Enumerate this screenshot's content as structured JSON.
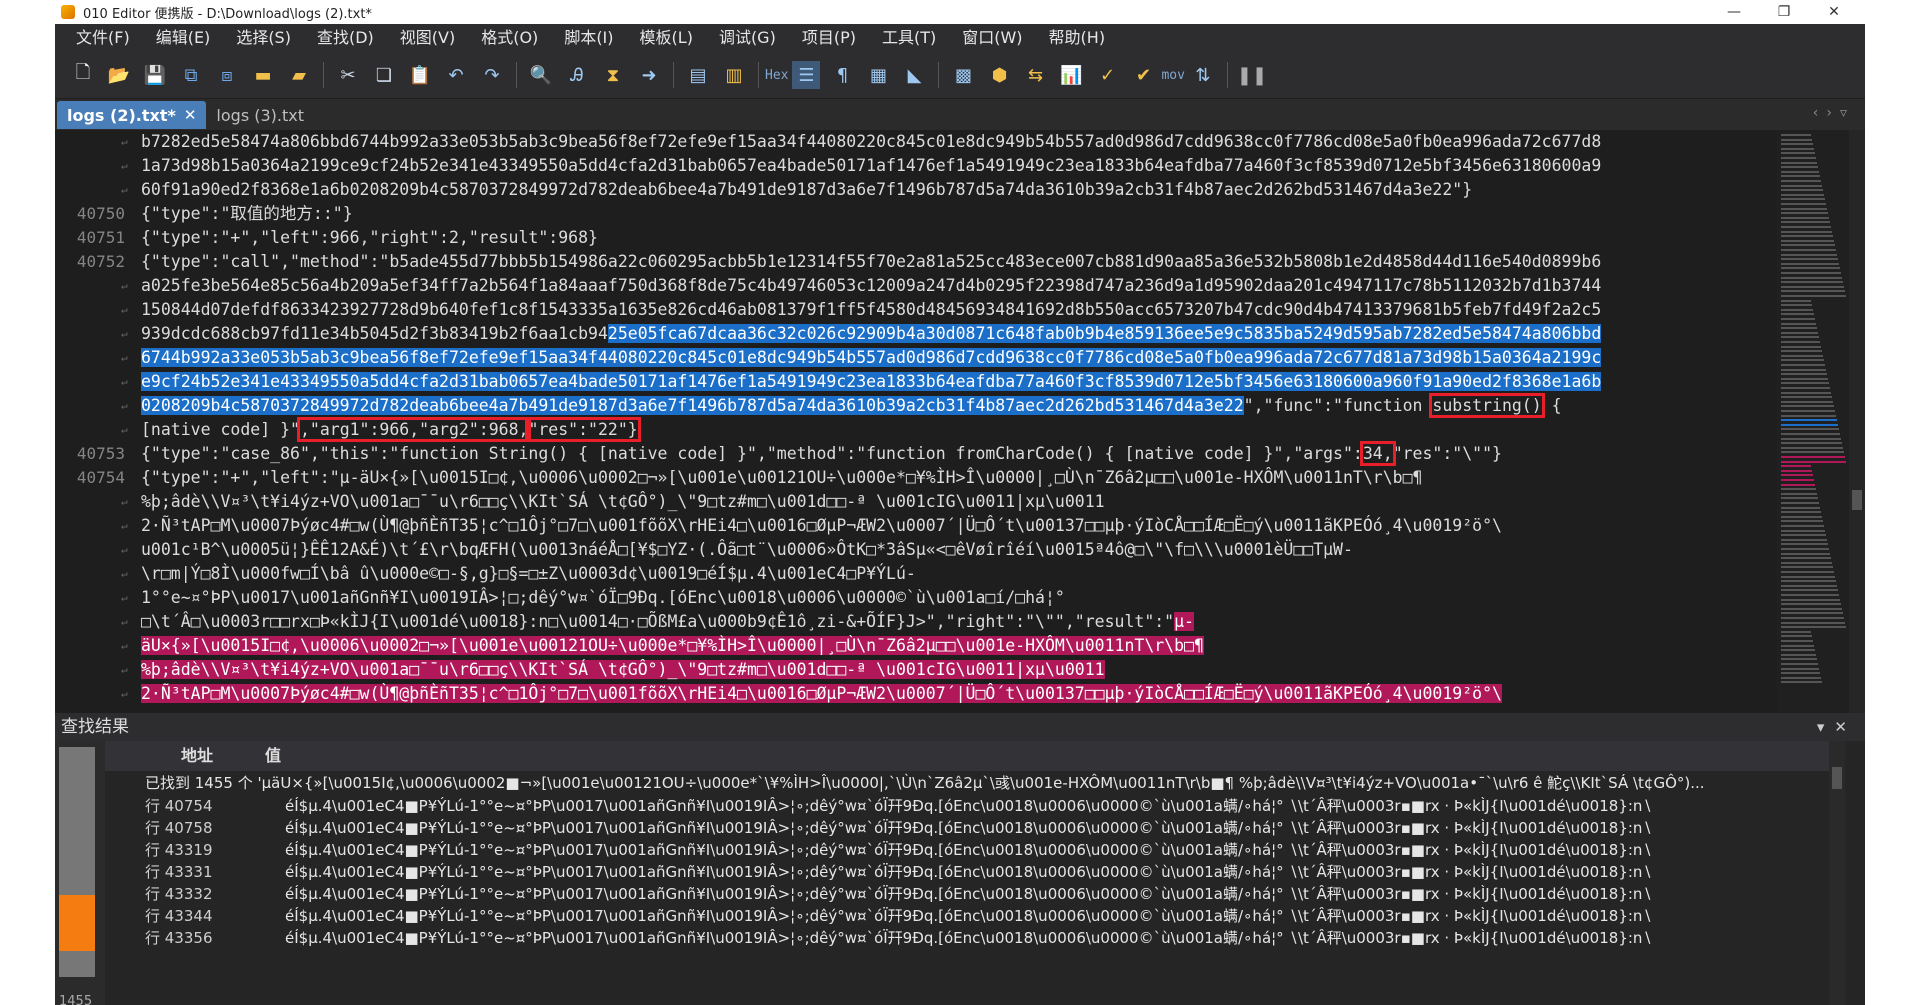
{
  "window": {
    "title": "010 Editor 便携版 - D:\\Download\\logs (2).txt*",
    "controls": [
      "—",
      "❐",
      "✕"
    ]
  },
  "menu": [
    "文件(F)",
    "编辑(E)",
    "选择(S)",
    "查找(D)",
    "视图(V)",
    "格式(O)",
    "脚本(I)",
    "模板(L)",
    "调试(G)",
    "项目(P)",
    "工具(T)",
    "窗口(W)",
    "帮助(H)"
  ],
  "toolbar": {
    "hex_label": "Hex",
    "mov_label": "mov",
    "icons": [
      "new-file-icon",
      "open-folder-icon",
      "save-icon",
      "save-all-icon",
      "save-as-icon",
      "folder-icon",
      "workspace-icon",
      "cut-icon",
      "copy-icon",
      "paste-icon",
      "undo-icon",
      "redo-icon",
      "find-icon",
      "find-replace-icon",
      "find-in-files-icon",
      "goto-icon",
      "script-icon",
      "template-icon",
      "hex-toggle-icon",
      "list-icon",
      "paragraph-icon",
      "columns-icon",
      "highlight-icon",
      "calculator-icon",
      "inspector-icon",
      "compare-icon",
      "histogram-icon",
      "checksum-icon",
      "verify-icon",
      "mov-icon",
      "convert-icon",
      "pause-icon"
    ]
  },
  "tabs": [
    {
      "label": "logs (2).txt*",
      "active": true
    },
    {
      "label": "logs (3).txt",
      "active": false
    }
  ],
  "editor": {
    "lines": [
      {
        "num": "",
        "text": "b7282ed5e58474a806bbd6744b992a33e053b5ab3c9bea56f8ef72efe9ef15aa34f44080220c845c01e8dc949b54b557ad0d986d7cdd9638cc0f7786cd08e5a0fb0ea996ada72c677d8"
      },
      {
        "num": "",
        "text": "1a73d98b15a0364a2199ce9cf24b52e341e43349550a5dd4cfa2d31bab0657ea4bade50171af1476ef1a5491949c23ea1833b64eafdba77a460f3cf8539d0712e5bf3456e63180600a9"
      },
      {
        "num": "",
        "text": "60f91a90ed2f8368e1a6b0208209b4c5870372849972d782deab6bee4a7b491de9187d3a6e7f1496b787d5a74da3610b39a2cb31f4b87aec2d262bd531467d4a3e22\"}"
      },
      {
        "num": "40750",
        "text": "{\"type\":\"取值的地方::\"}"
      },
      {
        "num": "40751",
        "text": "{\"type\":\"+\",\"left\":966,\"right\":2,\"result\":968}"
      },
      {
        "num": "40752",
        "text": "{\"type\":\"call\",\"method\":\"b5ade455d77bbb5b154986a22c060295acbb5b1e12314f55f70e2a81a525cc483ece007cb881d90aa85a36e532b5808b1e2d4858d44d116e540d0899b6"
      },
      {
        "num": "",
        "text": "a025fe3be564e85c56a4b209a5ef34ff7a2b564f1a84aaaf750d368f8de75c4b49746053c12009a247d4b0295f22398d747a236d9a1d95902daa201c4947117c78b5112032b7d1b3744"
      },
      {
        "num": "",
        "text": "150844d07defdf8633423927728d9b640fef1c8f1543335a1635e826cd46ab081379f1ff5f4580d48456934841692d8b550acc6573207b47cdc90d4b47413379681b5feb7fd49f2a2c5"
      },
      {
        "num": "",
        "pre": "939dcdc688cb97fd11e34b5045d2f3b83419b2f6aa1cb94",
        "sel": "25e05fca67dcaa36c32c026c92909b4a30d0871c648fab0b9b4e859136ee5e9c5835ba5249d595ab7282ed5e58474a806bbd"
      },
      {
        "num": "",
        "sel": "6744b992a33e053b5ab3c9bea56f8ef72efe9ef15aa34f44080220c845c01e8dc949b54b557ad0d986d7cdd9638cc0f7786cd08e5a0fb0ea996ada72c677d81a73d98b15a0364a2199c"
      },
      {
        "num": "",
        "sel": "e9cf24b52e341e43349550a5dd4cfa2d31bab0657ea4bade50171af1476ef1a5491949c23ea1833b64eafdba77a460f3cf8539d0712e5bf3456e63180600a960f91a90ed2f8368e1a6b"
      },
      {
        "num": "",
        "sel": "0208209b4c5870372849972d782deab6bee4a7b491de9187d3a6e7f1496b787d5a74da3610b39a2cb31f4b87aec2d262bd531467d4a3e22",
        "post": "\",\"func\":\"function ",
        "boxed": "substring()",
        "post2": " {"
      },
      {
        "num": "",
        "text_a": "[native code] }\"",
        "boxed_a": ",\"arg1\":966,\"arg2\":968,",
        "boxed_b": "\"res\":\"22\"}"
      },
      {
        "num": "40753",
        "text_a": "{\"type\":\"case_86\",\"this\":\"function String() { [native code] }\",\"method\":\"function fromCharCode() { [native code] }\",\"args\":",
        "boxed_a": "34,",
        "text_b": "\"res\":\"\\\"\"}"
      },
      {
        "num": "40754",
        "text": "{\"type\":\"+\",\"left\":\"µ-äU×{»[\\u0015I□¢,\\u0006\\u0002□¬»[\\u001e\\u00121OU÷\\u000e*□¥%ÌH>Î\\u0000|¸□Ù\\n¯Z6â2µ□□\\u001e-HXÔM\\u0011nT\\r\\b□¶"
      },
      {
        "num": "",
        "text": "%þ;âdè\\\\V¤³\\t¥i4ýz+VO\\u001a□¯¯u\\r6□□ç\\\\KIt`SÁ \\t¢GÔ°)_\\\"9□tz#m□\\u001d□□-ª \\u001cIG\\u0011|xµ\\u0011"
      },
      {
        "num": "",
        "text": "2·Ñ³tAP□M\\u0007Þýøc4#□w(Ù¶@þñÈñT35¦c^□1Ôj°□7□\\u001fõõX\\rHEi4□\\u0016□ØµP¬ÆW2\\u0007´|Ü□Ô´t\\u00137□□µþ·ýIòCÅ□□ÍÆ□Ë□ý\\u0011ãKPEÓó¸4\\u0019²ö°\\"
      },
      {
        "num": "",
        "text": "u001c¹B^\\u0005ü¦}ÊÊ12A&É)\\t´£\\r\\bqÆFH(\\u0013náéÅ□[¥$□YZ·(.Ôã□t¨\\u0006»ÔtK□*3âSµ«<□êVøîrîéí\\u0015ª4ô@□\\\"\\f□\\\\\\u0001èÜ□□TµW-"
      },
      {
        "num": "",
        "text": "\\r□m|Ý□8Ì\\u000fw□Í\\bâ û\\u000e©□-§,g}□§=□±Z\\u0003d¢\\u0019□éÍ$µ.4\\u001eC4□P¥ÝLú-"
      },
      {
        "num": "",
        "text": "1°°e~¤°ÞP\\u0017\\u001añGnñ¥I\\u0019IÂ>¦□;dêý°w¤`óÏ□9Đq.[óEnc\\u0018\\u0006\\u0000©`ù\\u001a□í/□há¦°"
      },
      {
        "num": "",
        "pre": "□\\t´Â□\\u0003r□□rx□Þ«kÌJ{I\\u001dé\\u0018}:n□\\u0014□·□ÕßM£a\\u000b9¢Ê1ô¸zi-&+ÕÍF}J>\",\"right\":\"\\\"\",\"result\":\"",
        "sel2": "µ-"
      },
      {
        "num": "",
        "sel2": "äU×{»[\\u0015I□¢,\\u0006\\u0002□¬»[\\u001e\\u00121OU÷\\u000e*□¥%ÌH>Î\\u0000|¸□Ù\\n¯Z6â2µ□□\\u001e-HXÔM\\u0011nT\\r\\b□¶"
      },
      {
        "num": "",
        "sel2": "%þ;âdè\\\\V¤³\\t¥i4ýz+VO\\u001a□¯¯u\\r6□□ç\\\\KIt`SÁ \\t¢GÔ°)_\\\"9□tz#m□\\u001d□□-ª \\u001cIG\\u0011|xµ\\u0011"
      },
      {
        "num": "",
        "sel2": "2·Ñ³tAP□M\\u0007Þýøc4#□w(Ù¶@þñÈñT35¦c^□1Ôj°□7□\\u001fõõX\\rHEi4□\\u0016□ØµP¬ÆW2\\u0007´|Ü□Ô´t\\u00137□□µþ·ýIòCÅ□□ÍÆ□Ë□ý\\u0011ãKPEÓó¸4\\u0019²ö°\\"
      }
    ]
  },
  "find_results": {
    "title": "查找结果",
    "col_address": "地址",
    "col_value": "值",
    "summary": "已找到 1455 个 'µäU×{»[\\u0015I¢,\\u0006\\u0002■¬»[\\u001e\\u00121OU÷\\u000e*`\\¥%ÌH>Î\\u0000|,`\\Ù\\n`Z6â2µ`\\彧\\u001e-HXÔM\\u0011nT\\r\\b■¶ %þ;âdè\\\\V¤³\\t¥i4ýz+VO\\u001a•¯`\\u\\r6 ê 鮀ç\\\\KIt`SÁ \\t¢GÔ°)...",
    "rows": [
      {
        "addr": "行 40754",
        "val": "éÍ$µ.4\\u001eC4■P¥ÝLú-1°°e~¤°ÞP\\u0017\\u001añGnñ¥I\\u0019IÂ>¦∘;dêý°w¤`óÏ幵9Đq.[óEnc\\u0018\\u0006\\u0000©`ù\\u001a螨/∘há¦°  ∖\\t´Â秤\\u0003r▪■rx · Þ«kÌJ{I\\u001dé\\u0018}:n∖"
      },
      {
        "addr": "行 40758",
        "val": "éÍ$µ.4\\u001eC4■P¥ÝLú-1°°e~¤°ÞP\\u0017\\u001añGnñ¥I\\u0019IÂ>¦∘;dêý°w¤`óÏ幵9Đq.[óEnc\\u0018\\u0006\\u0000©`ù\\u001a螨/∘há¦°  ∖\\t´Â秤\\u0003r▪■rx · Þ«kÌJ{I\\u001dé\\u0018}:n∖"
      },
      {
        "addr": "行 43319",
        "val": "éÍ$µ.4\\u001eC4■P¥ÝLú-1°°e~¤°ÞP\\u0017\\u001añGnñ¥I\\u0019IÂ>¦∘;dêý°w¤`óÏ幵9Đq.[óEnc\\u0018\\u0006\\u0000©`ù\\u001a螨/∘há¦°  ∖\\t´Â秤\\u0003r▪■rx · Þ«kÌJ{I\\u001dé\\u0018}:n∖"
      },
      {
        "addr": "行 43331",
        "val": "éÍ$µ.4\\u001eC4■P¥ÝLú-1°°e~¤°ÞP\\u0017\\u001añGnñ¥I\\u0019IÂ>¦∘;dêý°w¤`óÏ幵9Đq.[óEnc\\u0018\\u0006\\u0000©`ù\\u001a螨/∘há¦°  ∖\\t´Â秤\\u0003r▪■rx · Þ«kÌJ{I\\u001dé\\u0018}:n∖"
      },
      {
        "addr": "行 43332",
        "val": "éÍ$µ.4\\u001eC4■P¥ÝLú-1°°e~¤°ÞP\\u0017\\u001añGnñ¥I\\u0019IÂ>¦∘;dêý°w¤`óÏ幵9Đq.[óEnc\\u0018\\u0006\\u0000©`ù\\u001a螨/∘há¦°  ∖\\t´Â秤\\u0003r▪■rx · Þ«kÌJ{I\\u001dé\\u0018}:n∖"
      },
      {
        "addr": "行 43344",
        "val": "éÍ$µ.4\\u001eC4■P¥ÝLú-1°°e~¤°ÞP\\u0017\\u001añGnñ¥I\\u0019IÂ>¦∘;dêý°w¤`óÏ幵9Đq.[óEnc\\u0018\\u0006\\u0000©`ù\\u001a螨/∘há¦°  ∖\\t´Â秤\\u0003r▪■rx · Þ«kÌJ{I\\u001dé\\u0018}:n∖"
      },
      {
        "addr": "行 43356",
        "val": "éÍ$µ.4\\u001eC4■P¥ÝLú-1°°e~¤°ÞP\\u0017\\u001añGnñ¥I\\u0019IÂ>¦∘;dêý°w¤`óÏ幵9Đq.[óEnc\\u0018\\u0006\\u0000©`ù\\u001a螨/∘há¦°  ∖\\t´Â秤\\u0003r▪■rx · Þ«kÌJ{I\\u001dé\\u0018}:n∖"
      }
    ],
    "count_label": "1455"
  },
  "colors": {
    "selection_blue": "#1c6fc8",
    "selection_magenta": "#b0185a",
    "annotation_red": "#e81e2a",
    "progress_orange": "#f47c10"
  }
}
